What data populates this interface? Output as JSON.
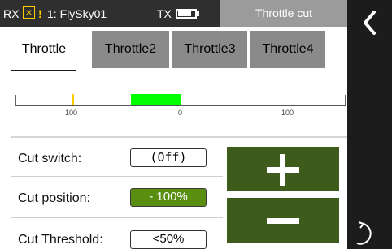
{
  "header": {
    "rx_label": "RX",
    "warning_mark": "!",
    "model_label": "1: FlySky01",
    "tx_label": "TX",
    "battery_level": 0.8,
    "screen_title": "Throttle cut"
  },
  "tabs": [
    {
      "label": "Throttle",
      "active": true
    },
    {
      "label": "Throttle2",
      "active": false
    },
    {
      "label": "Throttle3",
      "active": false
    },
    {
      "label": "Throttle4",
      "active": false
    }
  ],
  "scale": {
    "labels": [
      "100",
      "0",
      "100"
    ],
    "marker_value": -100,
    "bar_from": -30,
    "bar_to": 0
  },
  "rows": [
    {
      "label": "Cut switch:",
      "value": "(Off)"
    },
    {
      "label": "Cut position:",
      "value": "- 100%"
    },
    {
      "label": "Cut Threshold:",
      "value": "<50%"
    }
  ],
  "buttons": {
    "plus_icon": "plus-icon",
    "minus_icon": "minus-icon"
  },
  "nav": {
    "back_icon": "chevron-left-icon",
    "help_icon": "help-icon"
  },
  "colors": {
    "accent_green": "#5a8e10",
    "button_green": "#3d5b1b",
    "bar_green": "#00ff00",
    "marker_yellow": "#ffcc00"
  }
}
